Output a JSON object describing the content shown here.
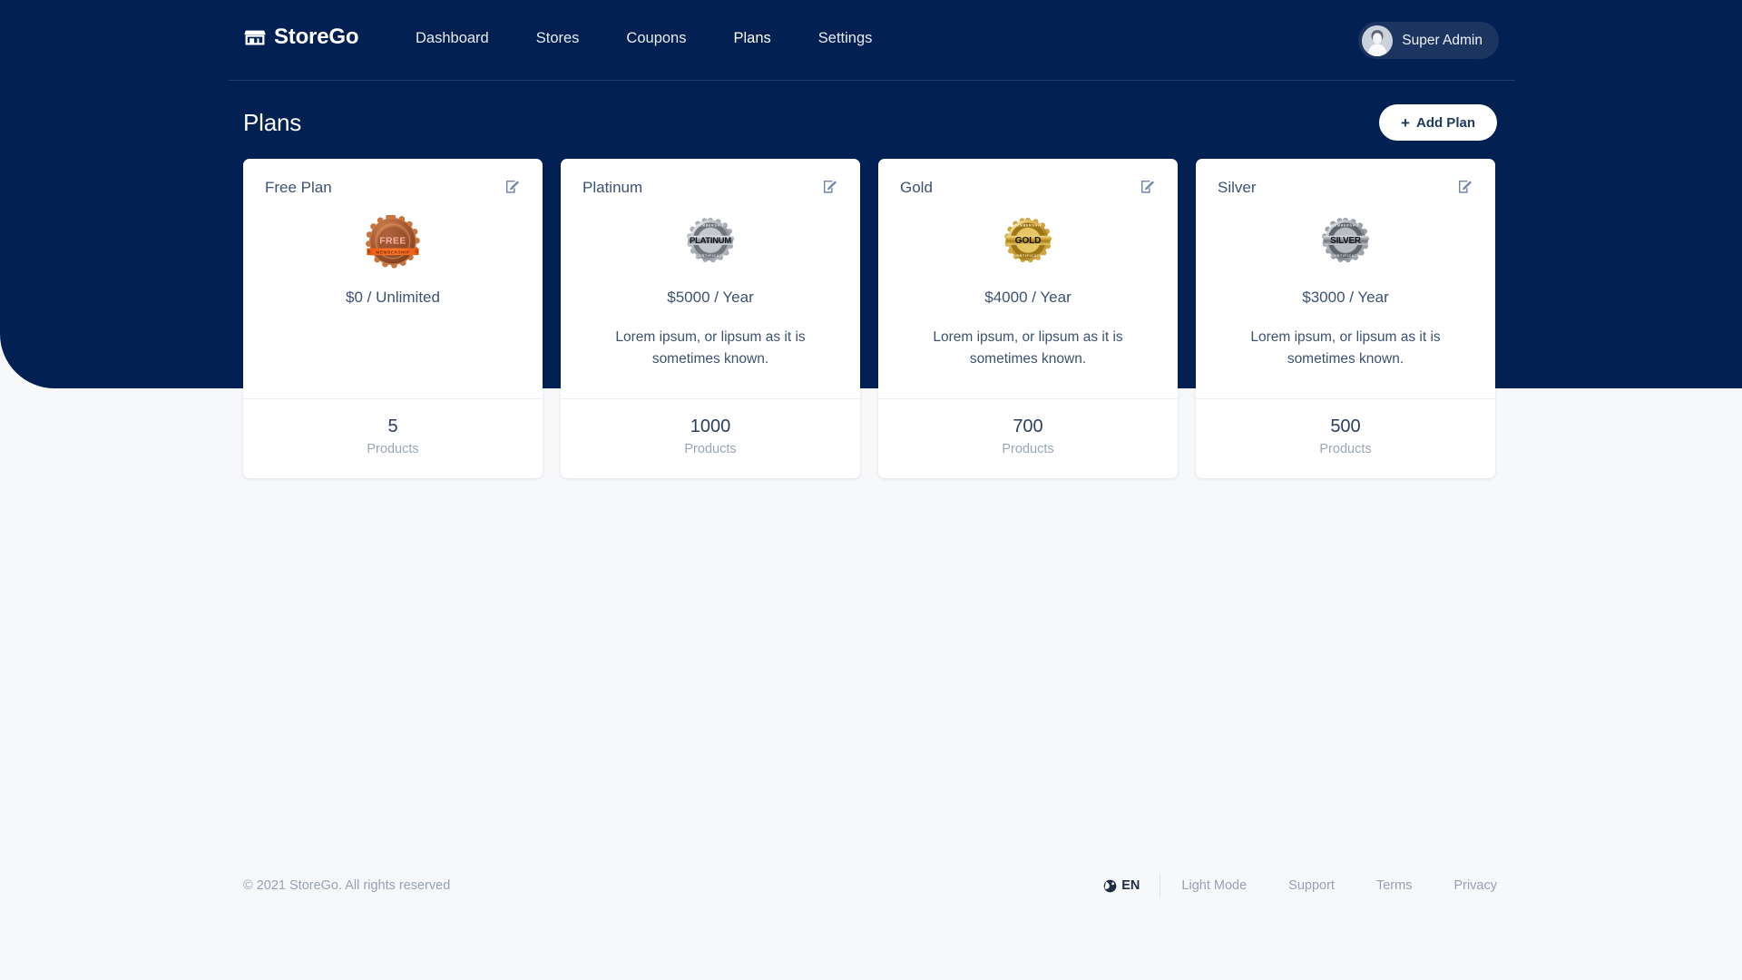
{
  "brand": {
    "name": "StoreGo",
    "icon": "storefront-icon"
  },
  "nav": {
    "items": [
      {
        "label": "Dashboard",
        "name": "nav-link-dashboard",
        "active": false
      },
      {
        "label": "Stores",
        "name": "nav-link-stores",
        "active": false
      },
      {
        "label": "Coupons",
        "name": "nav-link-coupons",
        "active": false
      },
      {
        "label": "Plans",
        "name": "nav-link-plans",
        "active": true
      },
      {
        "label": "Settings",
        "name": "nav-link-settings",
        "active": false
      }
    ]
  },
  "user": {
    "name": "Super Admin",
    "avatar_icon": "user-avatar-icon"
  },
  "header": {
    "title": "Plans",
    "add_button_label": "Add Plan",
    "add_button_icon": "plus-icon"
  },
  "cards": [
    {
      "title": "Free Plan",
      "badge": "free",
      "badge_text": "FREE",
      "badge_ribbon": "MEMBERSHIP",
      "price": "$0 / Unlimited",
      "description": "",
      "count": "5",
      "count_label": "Products",
      "edit_icon": "edit-pencil-icon"
    },
    {
      "title": "Platinum",
      "badge": "platinum",
      "badge_text": "PLATINUM",
      "badge_ribbon": "MEMBERSHIP",
      "price": "$5000 / Year",
      "description": "Lorem ipsum, or lipsum as it is sometimes known.",
      "count": "1000",
      "count_label": "Products",
      "edit_icon": "edit-pencil-icon"
    },
    {
      "title": "Gold",
      "badge": "gold",
      "badge_text": "GOLD",
      "badge_ribbon": "MEMBERSHIP",
      "price": "$4000 / Year",
      "description": "Lorem ipsum, or lipsum as it is sometimes known.",
      "count": "700",
      "count_label": "Products",
      "edit_icon": "edit-pencil-icon"
    },
    {
      "title": "Silver",
      "badge": "silver",
      "badge_text": "SILVER",
      "badge_ribbon": "MEMBERSHIP",
      "price": "$3000 / Year",
      "description": "Lorem ipsum, or lipsum as it is sometimes known.",
      "count": "500",
      "count_label": "Products",
      "edit_icon": "edit-pencil-icon"
    }
  ],
  "footer": {
    "copyright": "© 2021 StoreGo. All rights reserved",
    "language": "EN",
    "language_icon": "globe-icon",
    "links": [
      {
        "label": "Light Mode",
        "name": "footer-link-light-mode"
      },
      {
        "label": "Support",
        "name": "footer-link-support"
      },
      {
        "label": "Terms",
        "name": "footer-link-terms"
      },
      {
        "label": "Privacy",
        "name": "footer-link-privacy"
      }
    ]
  },
  "colors": {
    "header_bg": "#032052",
    "page_bg": "#f7f8fa",
    "card_bg": "#ffffff",
    "text_primary": "#3d5272",
    "text_muted": "#98a2b3",
    "accent_white": "#ffffff"
  }
}
